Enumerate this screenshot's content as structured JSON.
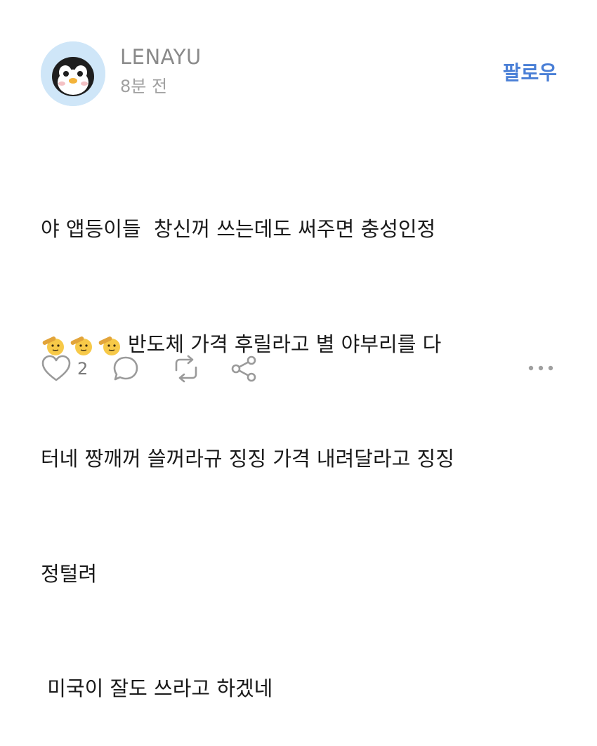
{
  "post": {
    "author": "LENAYU",
    "time": "8분 전",
    "follow_label": "팔로우",
    "lines": [
      "야 앱등이들  창신꺼 쓰는데도 써주면 충성인정",
      "반도체 가격 후릴라고 별 야부리를 다",
      "터네 짱깨꺼 쓸꺼라규 징징 가격 내려달라고 징징",
      "정털려",
      " 미국이 잘도 쓰라고 하겠네"
    ],
    "inline_emojis": [
      "saluting-face-emoji",
      "saluting-face-emoji",
      "saluting-face-emoji"
    ]
  },
  "actions": {
    "like_count": "2",
    "icons": [
      "heart-icon",
      "comment-icon",
      "repost-icon",
      "share-icon",
      "more-icon"
    ]
  },
  "colors": {
    "username": "#8a8a8a",
    "follow": "#4a7fd6",
    "icon": "#9a9a9a",
    "avatar_bg": "#cfe6f8"
  }
}
